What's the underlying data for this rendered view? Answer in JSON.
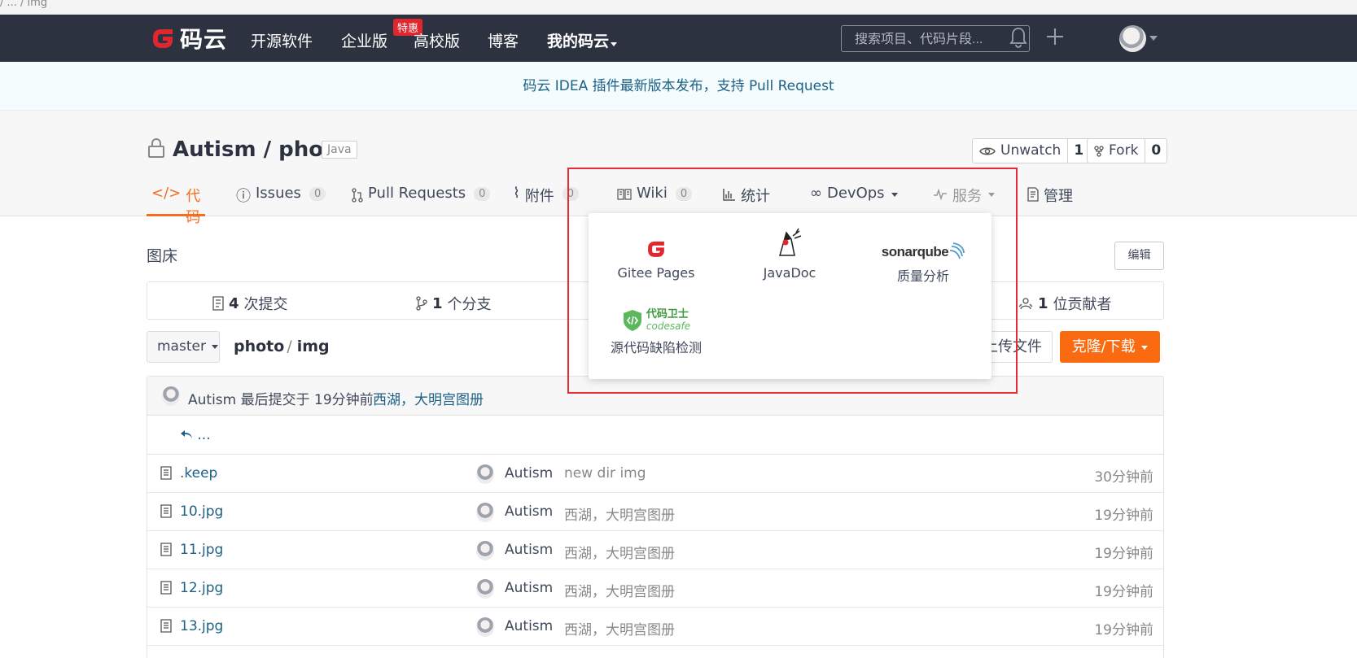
{
  "browser": {
    "path": "/ ... / img"
  },
  "nav": {
    "logo_text": "码云",
    "links": [
      "开源软件",
      "企业版",
      "高校版",
      "博客",
      "我的码云"
    ],
    "hot_badge": "特惠",
    "search_placeholder": "搜索项目、代码片段..."
  },
  "announcement": "码云 IDEA 插件最新版本发布，支持 Pull Request",
  "repo": {
    "title": "Autism / photo",
    "language": "Java",
    "watch_label": "Unwatch",
    "watch_count": "1",
    "fork_label": "Fork",
    "fork_count": "0"
  },
  "tabs": [
    {
      "label": "代码"
    },
    {
      "label": "Issues",
      "count": "0"
    },
    {
      "label": "Pull Requests",
      "count": "0"
    },
    {
      "label": "附件",
      "count": "0"
    },
    {
      "label": "Wiki",
      "count": "0"
    },
    {
      "label": "统计"
    },
    {
      "label": "DevOps"
    },
    {
      "label": "服务"
    },
    {
      "label": "管理"
    }
  ],
  "description": "图床",
  "edit_label": "编辑",
  "stats": {
    "commits_num": "4",
    "commits_label": "次提交",
    "branches_num": "1",
    "branches_label": "个分支",
    "contributors_num": "1",
    "contributors_label": "位贡献者"
  },
  "branch": "master",
  "breadcrumb": {
    "root": "photo",
    "sep": "/",
    "dir": "img"
  },
  "upload_label": "上传文件",
  "clone_label": "克隆/下载",
  "last_commit": {
    "author_text": "Autism 最后提交于 19分钟前",
    "message": "西湖，大明宫图册"
  },
  "up_text": "...",
  "files": [
    {
      "name": ".keep",
      "author": "Autism",
      "message": "new dir img",
      "time": "30分钟前"
    },
    {
      "name": "10.jpg",
      "author": "Autism",
      "message": "西湖，大明宫图册",
      "time": "19分钟前"
    },
    {
      "name": "11.jpg",
      "author": "Autism",
      "message": "西湖，大明宫图册",
      "time": "19分钟前"
    },
    {
      "name": "12.jpg",
      "author": "Autism",
      "message": "西湖，大明宫图册",
      "time": "19分钟前"
    },
    {
      "name": "13.jpg",
      "author": "Autism",
      "message": "西湖，大明宫图册",
      "time": "19分钟前"
    }
  ],
  "services": {
    "pages": "Gitee Pages",
    "javadoc": "JavaDoc",
    "sonar": "质量分析",
    "sonar_logo": "sonarqube",
    "codesafe": "源代码缺陷检测",
    "codesafe_logo_cn": "代码卫士",
    "codesafe_logo_en": "codesafe"
  },
  "colors": {
    "nav_bg": "#2d3240",
    "accent": "#f36e21",
    "clone_bg": "#fa6b11",
    "highlight": "#e8292f",
    "link": "#1d6186"
  }
}
